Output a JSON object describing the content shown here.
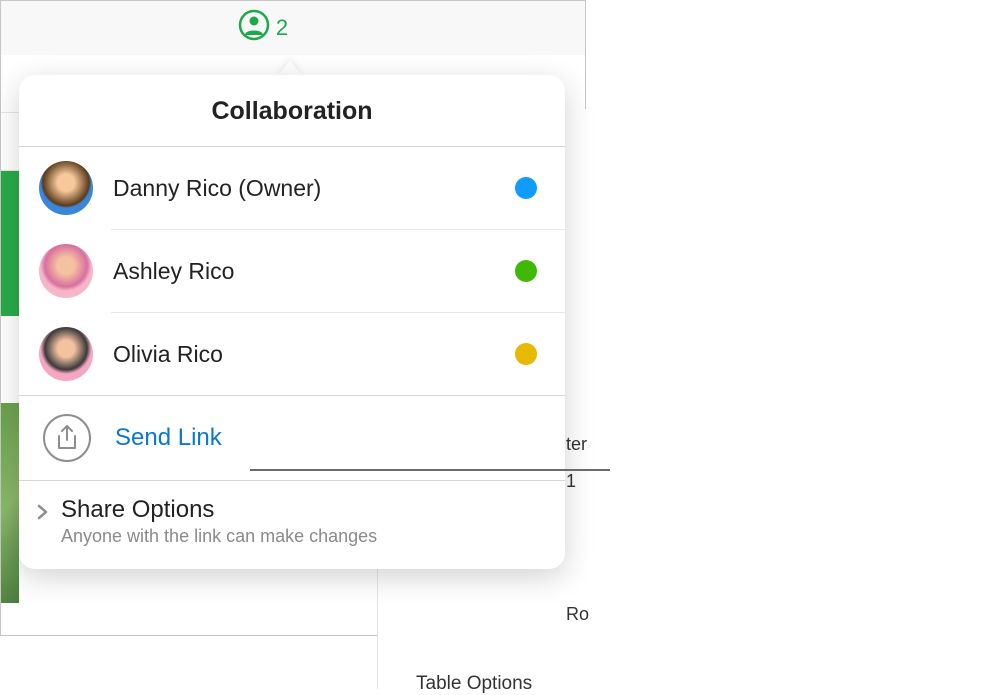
{
  "toolbar": {
    "collab_count": "2"
  },
  "popover": {
    "title": "Collaboration",
    "participants": [
      {
        "name": "Danny Rico (Owner)",
        "dot_color": "#0f9bff"
      },
      {
        "name": "Ashley Rico",
        "dot_color": "#3fb904"
      },
      {
        "name": "Olivia Rico",
        "dot_color": "#e7b901"
      }
    ],
    "send_link_label": "Send Link",
    "share_options": {
      "title": "Share Options",
      "description": "Anyone with the link can make changes"
    }
  },
  "background": {
    "sidebar_text_1": "ter",
    "sidebar_text_2": "1",
    "sidebar_text_3": "Ro",
    "sidebar_text_4": "Table Options"
  },
  "colors": {
    "accent_green": "#1fa84a",
    "link_blue": "#0b78d0"
  }
}
